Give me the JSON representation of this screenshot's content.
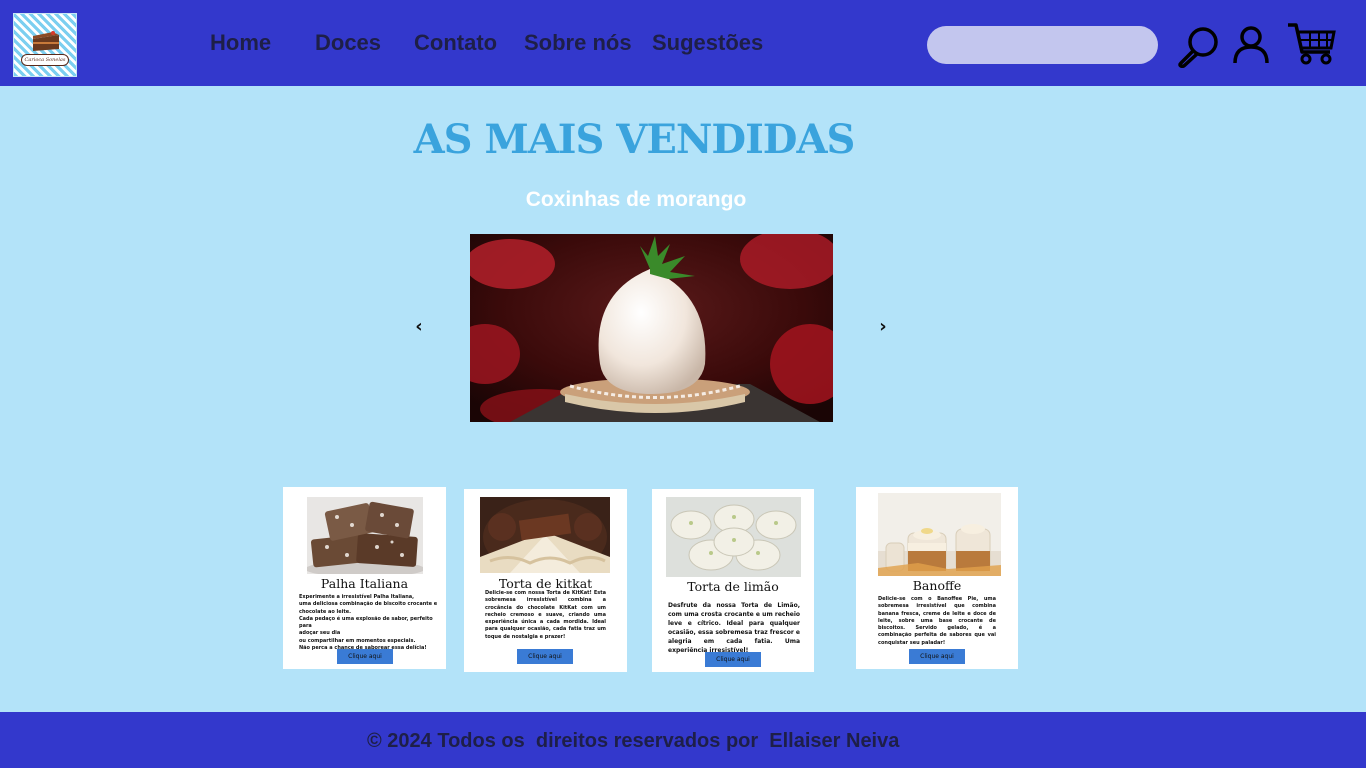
{
  "brand": {
    "logo_text": "Carioca Sonelas"
  },
  "nav": {
    "items": [
      {
        "label": "Home"
      },
      {
        "label": "Doces"
      },
      {
        "label": "Contato"
      },
      {
        "label": "Sobre nós"
      },
      {
        "label": "Sugestões"
      }
    ]
  },
  "header": {
    "search_placeholder": "",
    "icons": [
      "search-icon",
      "user-icon",
      "cart-icon"
    ]
  },
  "main": {
    "title": "AS MAIS VENDIDAS",
    "carousel": {
      "slide_title": "Coxinhas de morango",
      "prev_glyph": "‹",
      "next_glyph": "›"
    }
  },
  "cards": [
    {
      "title": "Palha Italiana",
      "desc_lines": [
        "Experimente a irresistível Palha Italiana,",
        "uma deliciosa combinação de biscoito crocante e",
        "chocolate ao leite.",
        "Cada pedaço é uma explosão de sabor, perfeito para",
        "adoçar seu dia",
        "ou compartilhar em momentos especiais.",
        "Não perca a chance de saborear essa delícia!"
      ],
      "button": "Clique aqui"
    },
    {
      "title": "Torta de kitkat",
      "desc": "Delicie-se com nossa Torta de KitKat! Esta sobremesa irresistível combina a crocância do chocolate KitKat com um recheio cremoso e suave, criando uma experiência única a cada mordida. Ideal para qualquer ocasião, cada fatia traz um toque de nostalgia e prazer!",
      "button": "Clique aqui"
    },
    {
      "title": "Torta de limão",
      "desc": "Desfrute da nossa Torta de Limão, com uma crosta crocante e um recheio leve e cítrico. Ideal para qualquer ocasião, essa sobremesa traz frescor e alegria em cada fatia. Uma experiência irresistível!",
      "button": "Clique aqui"
    },
    {
      "title": "Banoffe",
      "desc": "Delicie-se com o Banoffee Pie, uma sobremesa irresistível que combina banana fresca, creme de leite e doce de leite, sobre uma base crocante de biscoitos. Servido gelado, é a combinação perfeita de sabores que vai conquistar seu paladar!",
      "button": "Clique aqui"
    }
  ],
  "footer": {
    "text": "© 2024 Todos os  direitos reservados por  Ellaiser Neiva"
  },
  "colors": {
    "header_bg": "#3338cc",
    "page_bg": "#b3e3f9",
    "title": "#3aa3dd",
    "button": "#3a7bd5",
    "nav_text": "#1e1f48"
  }
}
